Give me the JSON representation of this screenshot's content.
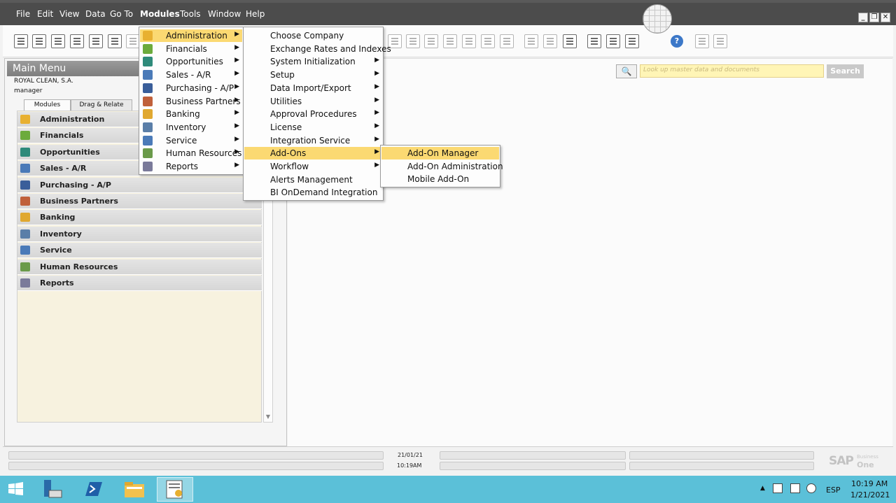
{
  "menubar": {
    "items": [
      "File",
      "Edit",
      "View",
      "Data",
      "Go To",
      "Modules",
      "Tools",
      "Window",
      "Help"
    ],
    "window_controls": [
      "_",
      "❐",
      "✕"
    ]
  },
  "main_menu": {
    "title": "Main Menu",
    "company": "ROYAL CLEAN, S.A.",
    "user": "manager",
    "tabs": [
      "Modules",
      "Drag & Relate"
    ],
    "modules": [
      {
        "label": "Administration",
        "icon": "administration-icon",
        "color": "#e8b030"
      },
      {
        "label": "Financials",
        "icon": "financials-icon",
        "color": "#6cab3c"
      },
      {
        "label": "Opportunities",
        "icon": "opportunities-icon",
        "color": "#2e8a7a"
      },
      {
        "label": "Sales - A/R",
        "icon": "sales-icon",
        "color": "#4a7ab8"
      },
      {
        "label": "Purchasing - A/P",
        "icon": "purchasing-icon",
        "color": "#3a5e9a"
      },
      {
        "label": "Business Partners",
        "icon": "business-partners-icon",
        "color": "#c0603a"
      },
      {
        "label": "Banking",
        "icon": "banking-icon",
        "color": "#e0a830"
      },
      {
        "label": "Inventory",
        "icon": "inventory-icon",
        "color": "#5a7ea8"
      },
      {
        "label": "Service",
        "icon": "service-icon",
        "color": "#4a7ab8"
      },
      {
        "label": "Human Resources",
        "icon": "human-resources-icon",
        "color": "#6a9a4a"
      },
      {
        "label": "Reports",
        "icon": "reports-icon",
        "color": "#7a7a9a"
      }
    ]
  },
  "search": {
    "placeholder": "Look up master data and documents",
    "button_label": "Search"
  },
  "modules_menu": {
    "items": [
      {
        "label": "Administration",
        "icon": "administration-icon",
        "color": "#e8b030"
      },
      {
        "label": "Financials",
        "icon": "financials-icon",
        "color": "#6cab3c"
      },
      {
        "label": "Opportunities",
        "icon": "opportunities-icon",
        "color": "#2e8a7a"
      },
      {
        "label": "Sales - A/R",
        "icon": "sales-icon",
        "color": "#4a7ab8"
      },
      {
        "label": "Purchasing - A/P",
        "icon": "purchasing-icon",
        "color": "#3a5e9a"
      },
      {
        "label": "Business Partners",
        "icon": "business-partners-icon",
        "color": "#c0603a"
      },
      {
        "label": "Banking",
        "icon": "banking-icon",
        "color": "#e0a830"
      },
      {
        "label": "Inventory",
        "icon": "inventory-icon",
        "color": "#5a7ea8"
      },
      {
        "label": "Service",
        "icon": "service-icon",
        "color": "#4a7ab8"
      },
      {
        "label": "Human Resources",
        "icon": "human-resources-icon",
        "color": "#6a9a4a"
      },
      {
        "label": "Reports",
        "icon": "reports-icon",
        "color": "#7a7a9a"
      }
    ]
  },
  "admin_menu": {
    "items": [
      {
        "label": "Choose Company",
        "submenu": false
      },
      {
        "label": "Exchange Rates and Indexes",
        "submenu": false
      },
      {
        "label": "System Initialization",
        "submenu": true
      },
      {
        "label": "Setup",
        "submenu": true
      },
      {
        "label": "Data Import/Export",
        "submenu": true
      },
      {
        "label": "Utilities",
        "submenu": true
      },
      {
        "label": "Approval Procedures",
        "submenu": true
      },
      {
        "label": "License",
        "submenu": true
      },
      {
        "label": "Integration Service",
        "submenu": true
      },
      {
        "label": "Add-Ons",
        "submenu": true
      },
      {
        "label": "Workflow",
        "submenu": true
      },
      {
        "label": "Alerts Management",
        "submenu": false
      },
      {
        "label": "BI OnDemand Integration",
        "submenu": false
      }
    ]
  },
  "addons_menu": {
    "items": [
      "Add-On Manager",
      "Add-On Administration",
      "Mobile Add-On"
    ]
  },
  "statusbar": {
    "date": "21/01/21",
    "time": "10:19AM",
    "brand": "SAP",
    "brand_small": "Business",
    "brand_one": "One"
  },
  "taskbar": {
    "language": "ESP",
    "clock_time": "10:19 AM",
    "clock_date": "1/21/2021"
  },
  "colors": {
    "highlight": "#fbd972",
    "taskbar": "#5bc0d8",
    "menubar": "#4c4c4c"
  }
}
